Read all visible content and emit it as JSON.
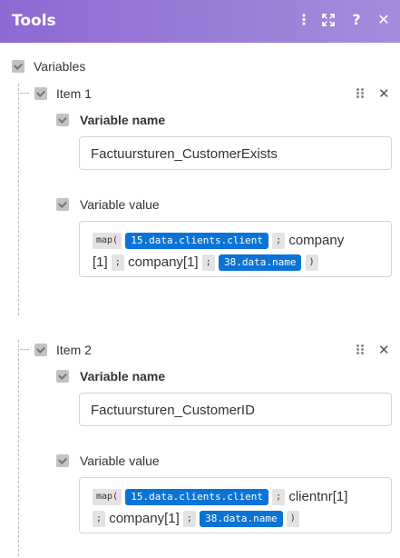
{
  "header": {
    "title": "Tools"
  },
  "section": {
    "label": "Variables"
  },
  "items": [
    {
      "label": "Item 1",
      "name_label": "Variable name",
      "name_value": "Factuursturen_CustomerExists",
      "value_label": "Variable value",
      "expr": {
        "fn": "map(",
        "pill1": "15.data.clients.client",
        "sep1": ";",
        "text1": "company",
        "text2": "[1]",
        "sep2": ";",
        "text3": "company[1]",
        "sep3": ";",
        "pill2": "38.data.name",
        "close": ")"
      }
    },
    {
      "label": "Item 2",
      "name_label": "Variable name",
      "name_value": "Factuursturen_CustomerID",
      "value_label": "Variable value",
      "expr": {
        "fn": "map(",
        "pill1": "15.data.clients.client",
        "sep1": ";",
        "text1": "clientnr[1]",
        "sep2": ";",
        "text2": "company[1]",
        "sep3": ";",
        "pill2": "38.data.name",
        "close": ")"
      }
    }
  ]
}
